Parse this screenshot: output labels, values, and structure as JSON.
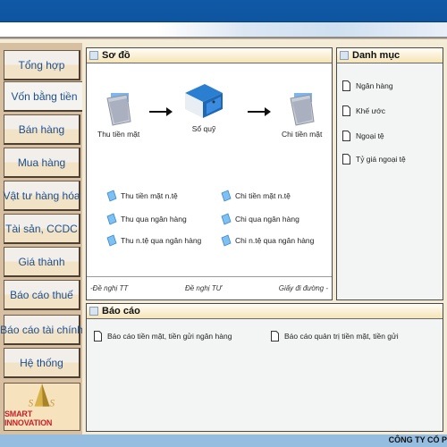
{
  "sidebar": {
    "items": [
      {
        "label": "Tổng hợp",
        "active": false
      },
      {
        "label": "Vốn bằng tiền",
        "active": true
      },
      {
        "label": "Bán hàng",
        "active": false
      },
      {
        "label": "Mua hàng",
        "active": false
      },
      {
        "label": "Vật tư hàng hóa",
        "active": false
      },
      {
        "label": "Tài sản, CCDC",
        "active": false
      },
      {
        "label": "Giá thành",
        "active": false
      },
      {
        "label": "Báo cáo thuế",
        "active": false
      },
      {
        "label": "Báo cáo tài chính",
        "active": false
      },
      {
        "label": "Hệ thống",
        "active": false
      }
    ],
    "logo_text": "SMART INNOVATION"
  },
  "sodo": {
    "title": "Sơ đồ",
    "flow": {
      "thu": "Thu tiền mặt",
      "soquy": "Sổ quỹ",
      "chi": "Chi tiền mặt"
    },
    "left_links": [
      "Thu tiền mặt n.tệ",
      "Thu qua ngân hàng",
      "Thu n.tệ qua ngân hàng"
    ],
    "right_links": [
      "Chi tiền mặt n.tệ",
      "Chi qua ngân hàng",
      "Chi n.tệ qua ngân hàng"
    ],
    "footer": {
      "left": "-Đề nghị TT",
      "middle": "Đề nghị TƯ",
      "right": "Giấy đi đường -"
    }
  },
  "danhmuc": {
    "title": "Danh mục",
    "items": [
      "Ngân hàng",
      "Khế ước",
      "Ngoại tệ",
      "Tỷ giá ngoại tệ"
    ]
  },
  "baocao": {
    "title": "Báo cáo",
    "items": [
      "Báo cáo tiền mặt, tiền gửi ngân hàng",
      "Báo cáo quản trị tiền mặt, tiền gửi"
    ]
  },
  "status": {
    "company": "CÔNG TY CỔ P"
  },
  "colors": {
    "titlebar": "#1059a6",
    "nav_text": "#1d4f8e",
    "logo_red": "#c8202a",
    "statusbar": "#95bde0"
  }
}
